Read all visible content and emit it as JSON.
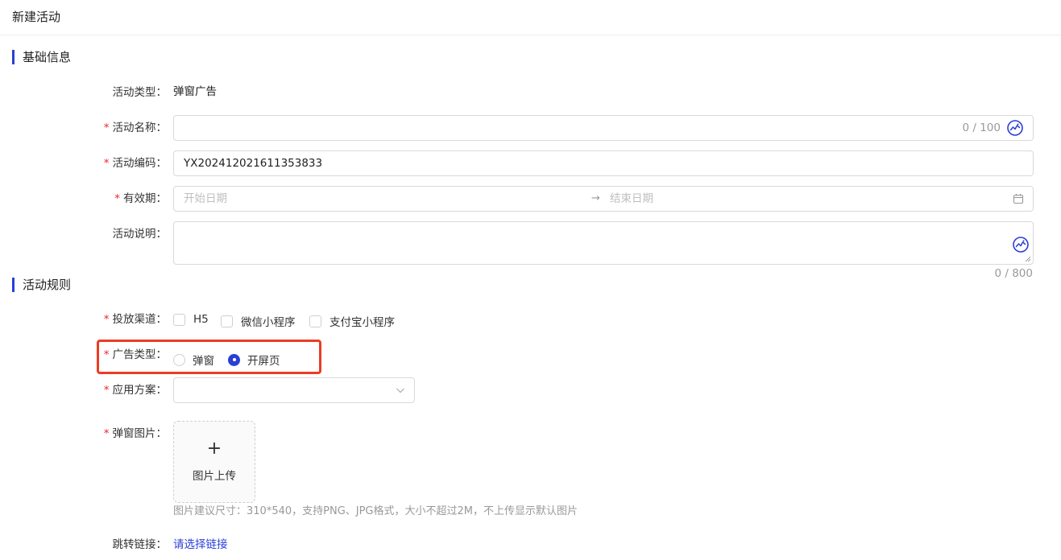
{
  "header": {
    "title": "新建活动"
  },
  "sections": {
    "basic": "基础信息",
    "rules": "活动规则"
  },
  "basic": {
    "activity_type": {
      "label": "活动类型：",
      "value": "弹窗广告"
    },
    "activity_name": {
      "label": "活动名称：",
      "value": "",
      "counter": "0 / 100"
    },
    "activity_code": {
      "label": "活动编码：",
      "value": "YX202412021611353833"
    },
    "validity": {
      "label": "有效期：",
      "start_placeholder": "开始日期",
      "end_placeholder": "结束日期",
      "separator": "→"
    },
    "description": {
      "label": "活动说明：",
      "value": "",
      "counter": "0 / 800"
    }
  },
  "rules": {
    "channels": {
      "label": "投放渠道：",
      "options": [
        {
          "label": "H5",
          "checked": false
        },
        {
          "label": "微信小程序",
          "checked": false
        },
        {
          "label": "支付宝小程序",
          "checked": false
        }
      ]
    },
    "ad_type": {
      "label": "广告类型：",
      "options": [
        {
          "label": "弹窗",
          "checked": false
        },
        {
          "label": "开屏页",
          "checked": true
        }
      ]
    },
    "scheme": {
      "label": "应用方案：",
      "value": ""
    },
    "popup_image": {
      "label": "弹窗图片：",
      "upload_plus": "+",
      "upload_label": "图片上传",
      "hint": "图片建议尺寸：310*540，支持PNG、JPG格式，大小不超过2M，不上传显示默认图片"
    },
    "jump_link": {
      "label": "跳转链接：",
      "link_text": "请选择链接"
    }
  },
  "colors": {
    "accent": "#2a3fd6",
    "required": "#f5222d",
    "highlight": "#ea3d24"
  },
  "icons": {
    "ai": "ai-assist-icon",
    "calendar": "calendar-icon",
    "chevron": "chevron-down-icon"
  }
}
